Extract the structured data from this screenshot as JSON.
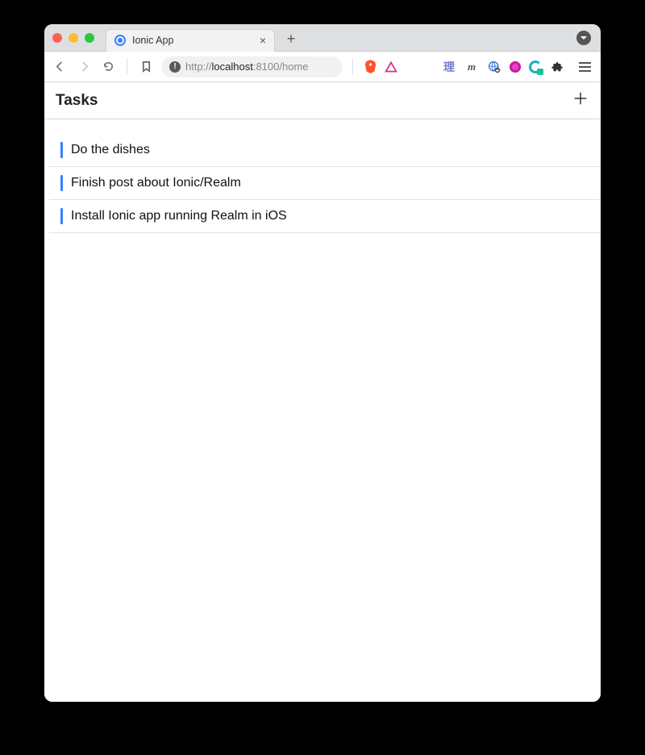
{
  "browser": {
    "tab_title": "Ionic App",
    "url_scheme": "http://",
    "url_host": "localhost",
    "url_port_path": ":8100/home",
    "extensions": {
      "ri_label": "理",
      "m_label": "m"
    }
  },
  "app": {
    "header_title": "Tasks"
  },
  "tasks": [
    {
      "title": "Do the dishes"
    },
    {
      "title": "Finish post about Ionic/Realm"
    },
    {
      "title": "Install Ionic app running Realm in iOS"
    }
  ],
  "colors": {
    "accent": "#3880ff"
  }
}
